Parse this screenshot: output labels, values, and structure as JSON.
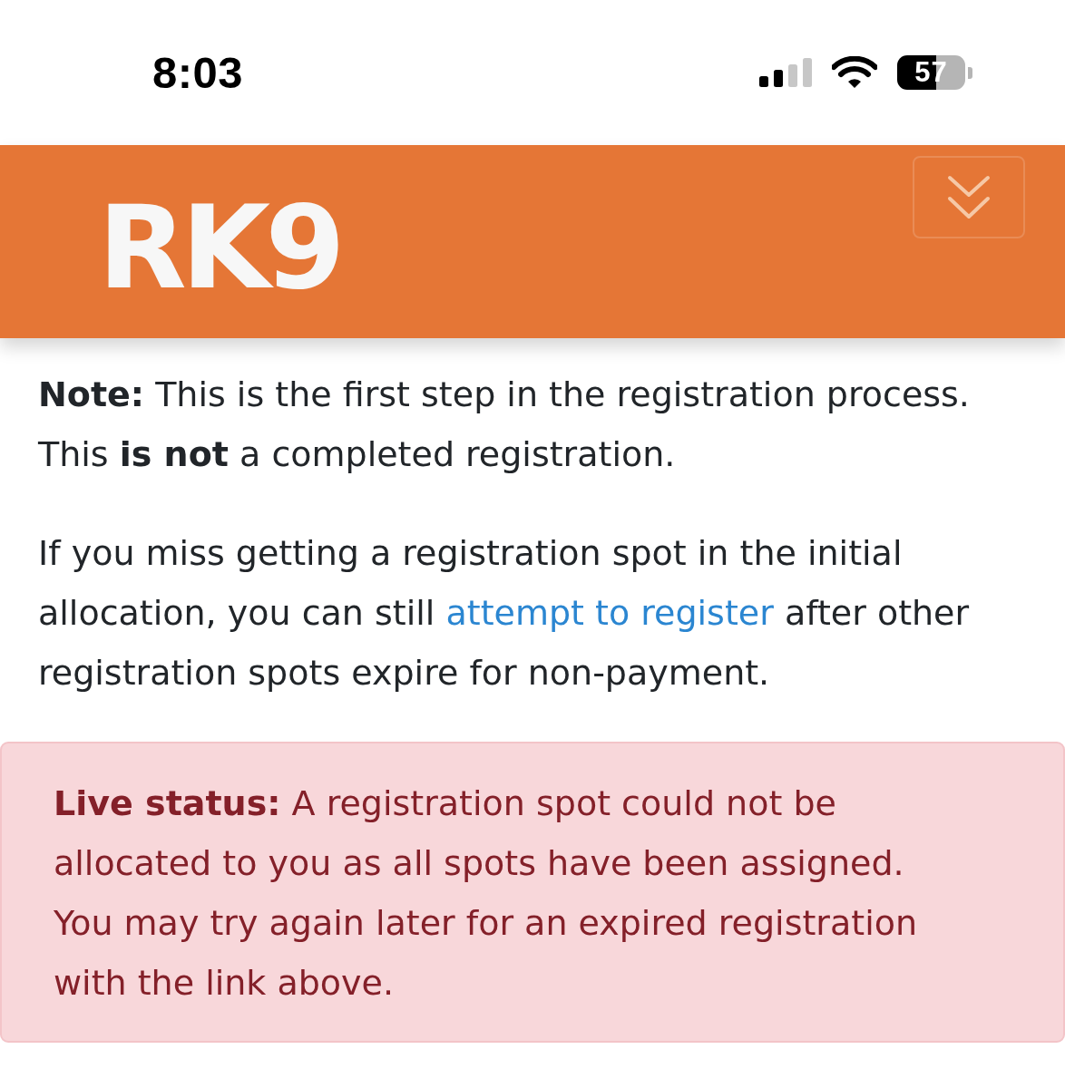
{
  "status_bar": {
    "time": "8:03",
    "battery": "57"
  },
  "header": {
    "logo": "RK9"
  },
  "paragraphs": [
    {
      "text": "**Note:** This is the first step in the registration process. This **is not** a completed registration."
    },
    {
      "text": "If you miss getting a registration spot in the initial allocation, you can still ",
      "link": "attempt to register",
      "text_after": " after other registration spots expire for non-payment."
    }
  ],
  "alert": {
    "text": "**Live status:** A registration spot could not be allocated to you as all spots have been assigned. You may try again later for an expired registration with the link above."
  }
}
